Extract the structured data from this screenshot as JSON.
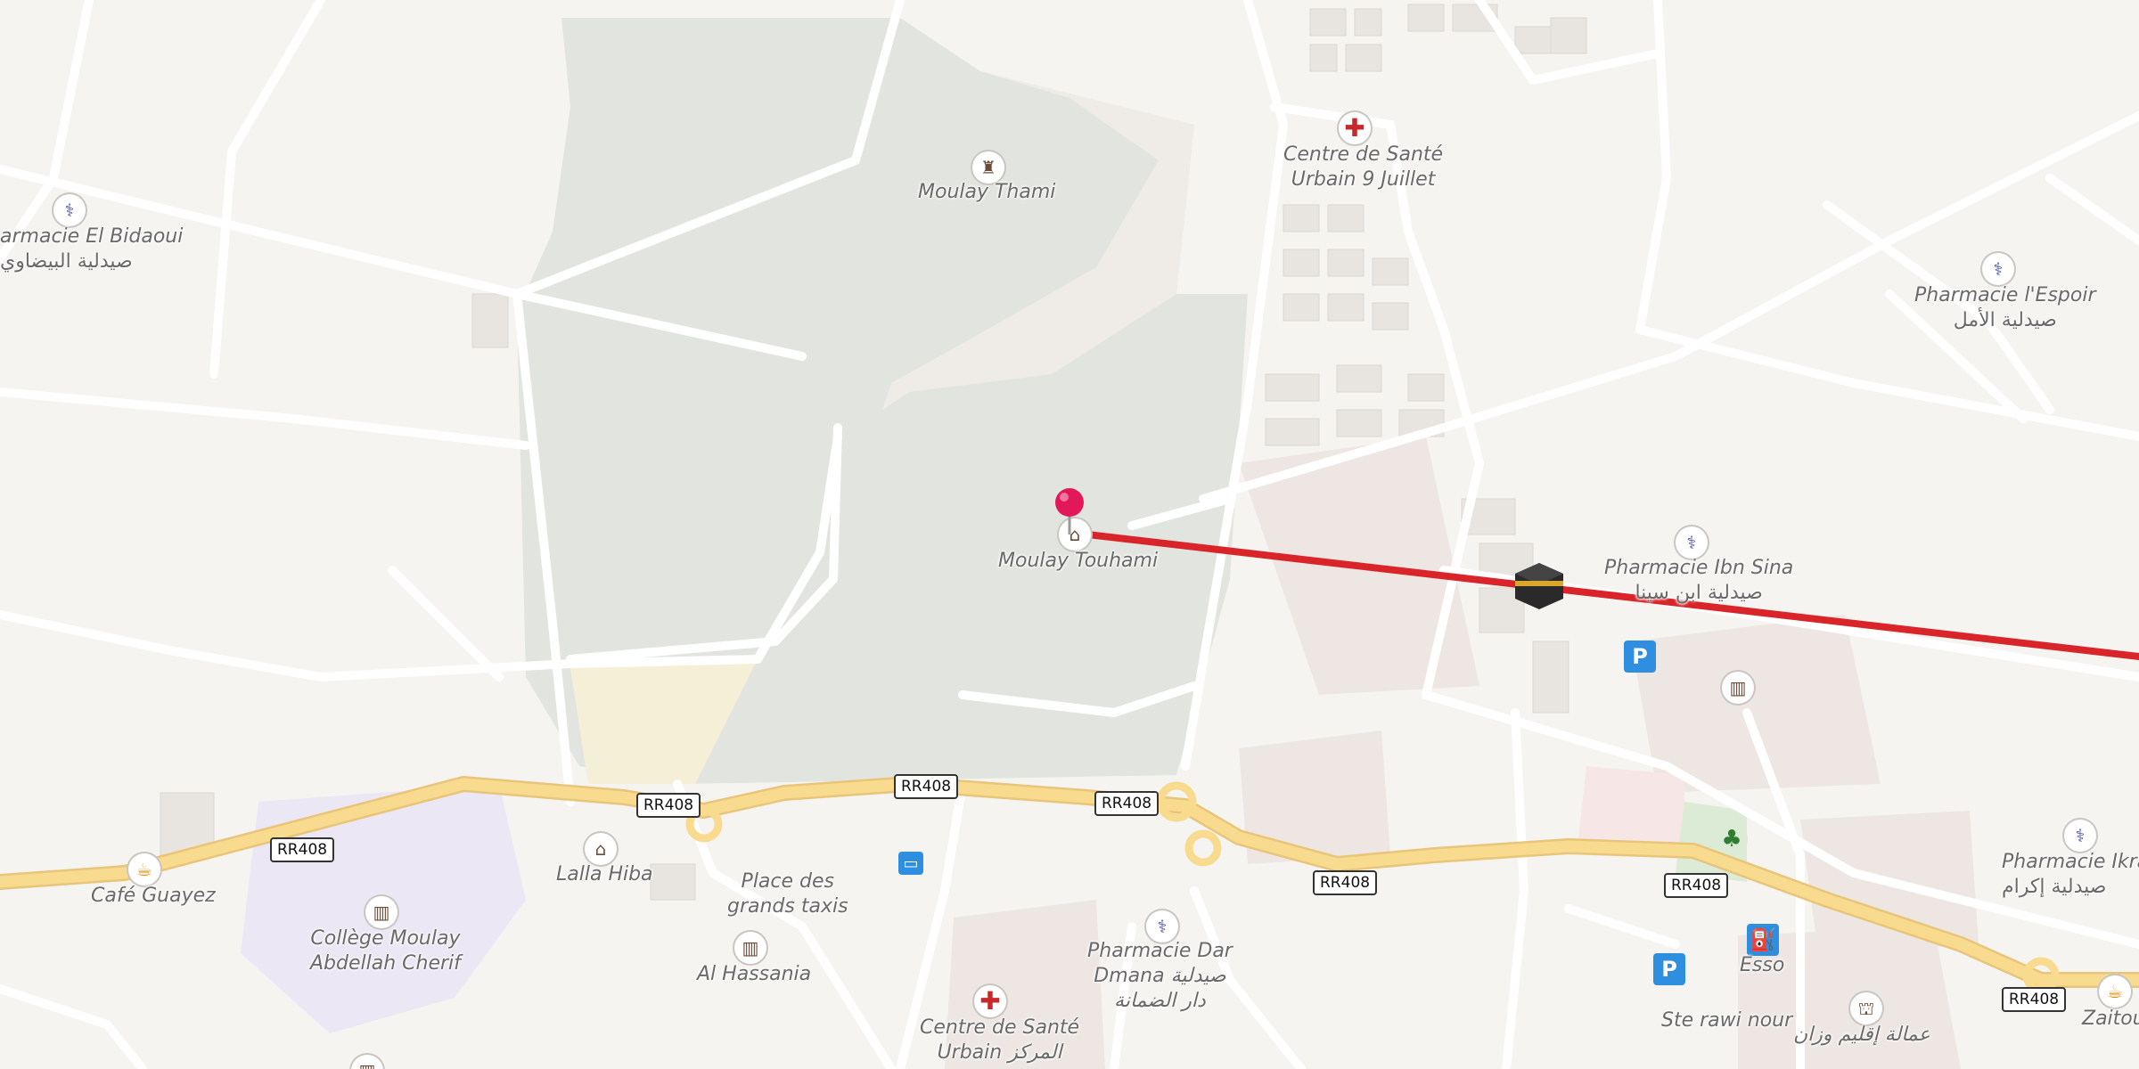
{
  "map": {
    "colors": {
      "background": "#f6f4f1",
      "road_minor": "#ffffff",
      "road_major": "#f8db8e",
      "park": "#e2e5df",
      "route": "#d9252a",
      "pin": "#e2185b"
    },
    "labels": [
      {
        "id": "moulay-thami",
        "text": "Moulay Thami",
        "icon": "tomb-icon"
      },
      {
        "id": "moulay-touhami",
        "text": "Moulay Touhami",
        "icon": "mausoleum-icon"
      },
      {
        "id": "centre-sante-9-juillet",
        "line1": "Centre de Santé",
        "line2": "Urbain 9 Juillet",
        "icon": "medical-cross-icon"
      },
      {
        "id": "pharmacie-el-bidaoui",
        "line1": "armacie El Bidaoui",
        "line2": "صيدلية البيضاوي",
        "icon": "pharmacy-icon"
      },
      {
        "id": "pharmacie-l-espoir",
        "line1": "Pharmacie l'Espoir",
        "line2": "صيدلية الأمل",
        "icon": "pharmacy-icon"
      },
      {
        "id": "pharmacie-ibn-sina",
        "line1": "Pharmacie Ibn Sina",
        "line2": "صيدلية ابن سينا",
        "icon": "pharmacy-icon"
      },
      {
        "id": "pharmacie-ikram",
        "line1": "Pharmacie Ikra",
        "line2": "صيدلية إكرام",
        "icon": "pharmacy-icon"
      },
      {
        "id": "pharmacie-dar-dmana",
        "line1": "Pharmacie Dar",
        "line2": "Dmana صيدلية",
        "line3": "دار الضمانة",
        "icon": "pharmacy-icon"
      },
      {
        "id": "cafe-guayez",
        "text": "Café Guayez",
        "icon": "cafe-icon"
      },
      {
        "id": "lalla-hiba",
        "text": "Lalla Hiba",
        "icon": "mausoleum-icon"
      },
      {
        "id": "place-grands-taxis",
        "line1": "Place des",
        "line2": "grands taxis"
      },
      {
        "id": "college-moulay",
        "line1": "Collège Moulay",
        "line2": "Abdellah Cherif",
        "icon": "school-icon"
      },
      {
        "id": "al-hassania",
        "text": "Al Hassania",
        "icon": "school-icon"
      },
      {
        "id": "centre-sante-urbain",
        "line1": "Centre de Santé",
        "line2": "Urbain المركز",
        "icon": "medical-cross-icon"
      },
      {
        "id": "esso",
        "text": "Esso",
        "icon": "fuel-icon"
      },
      {
        "id": "ste-rawi-nour",
        "text": "Ste rawi nour"
      },
      {
        "id": "amalat-ouazzane",
        "text": "عمالة إقليم وزان",
        "icon": "government-icon"
      },
      {
        "id": "zaitoun",
        "text": "Zaitoun",
        "icon": "cafe-icon"
      }
    ],
    "road_shields": [
      "RR408",
      "RR408",
      "RR408",
      "RR408",
      "RR408",
      "RR408",
      "RR408"
    ],
    "parking_symbol": "P",
    "icons": {
      "pharmacy": "⚕",
      "cross": "✚",
      "tomb": "♜",
      "mausoleum": "⌂",
      "school": "▥",
      "cafe": "☕",
      "fuel": "⛽",
      "bus": "▭",
      "tree": "♣",
      "government": "⛫"
    }
  }
}
